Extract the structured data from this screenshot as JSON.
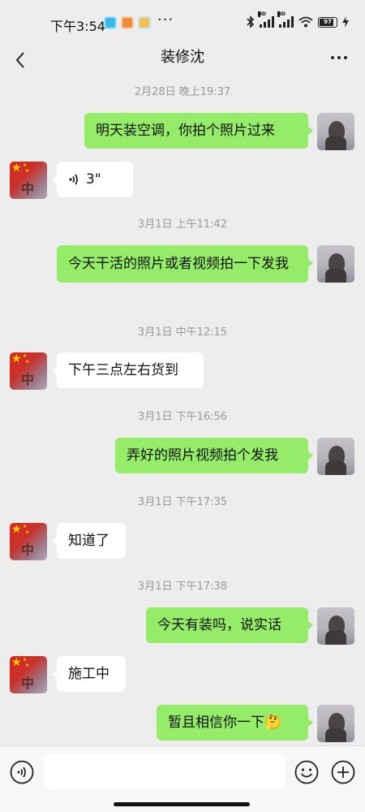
{
  "status_bar": {
    "time": "下午3:54",
    "dots": "···",
    "battery": "97",
    "signal_hd_1": "HD",
    "signal_hd_2": "HD",
    "icons": [
      "bluetooth-icon",
      "signal-icon",
      "signal-icon",
      "wifi-icon",
      "battery-icon",
      "charging-icon"
    ]
  },
  "header": {
    "title": "装修沈",
    "back_icon": "chevron-left-icon",
    "more_icon": "more-dots-icon"
  },
  "messages": [
    {
      "type": "timestamp",
      "text": "2月28日 晚上19:37"
    },
    {
      "type": "message",
      "from": "me",
      "text": "明天装空调，你拍个照片过来"
    },
    {
      "type": "voice",
      "from": "other",
      "duration": "3\""
    },
    {
      "type": "timestamp",
      "text": "3月1日 上午11:42"
    },
    {
      "type": "message",
      "from": "me",
      "text": "今天干活的照片或者视频拍一下发我"
    },
    {
      "type": "timestamp",
      "text": "3月1日 中午12:15"
    },
    {
      "type": "message",
      "from": "other",
      "text": "下午三点左右货到"
    },
    {
      "type": "timestamp",
      "text": "3月1日 下午16:56"
    },
    {
      "type": "message",
      "from": "me",
      "text": "弄好的照片视频拍个发我"
    },
    {
      "type": "timestamp",
      "text": "3月1日 下午17:35"
    },
    {
      "type": "message",
      "from": "other",
      "text": "知道了"
    },
    {
      "type": "timestamp",
      "text": "3月1日 下午17:38"
    },
    {
      "type": "message",
      "from": "me",
      "text": "今天有装吗，说实话"
    },
    {
      "type": "message",
      "from": "other",
      "text": "施工中"
    },
    {
      "type": "message",
      "from": "me",
      "text": "暂且相信你一下",
      "emoji": "🤔"
    }
  ],
  "input_bar": {
    "value": "",
    "placeholder": "",
    "icons": [
      "voice-mode-icon",
      "emoji-icon",
      "plus-icon"
    ]
  },
  "colors": {
    "background": "#ededed",
    "my_bubble": "#95ec69",
    "other_bubble": "#ffffff",
    "timestamp": "#9a9a9a"
  }
}
